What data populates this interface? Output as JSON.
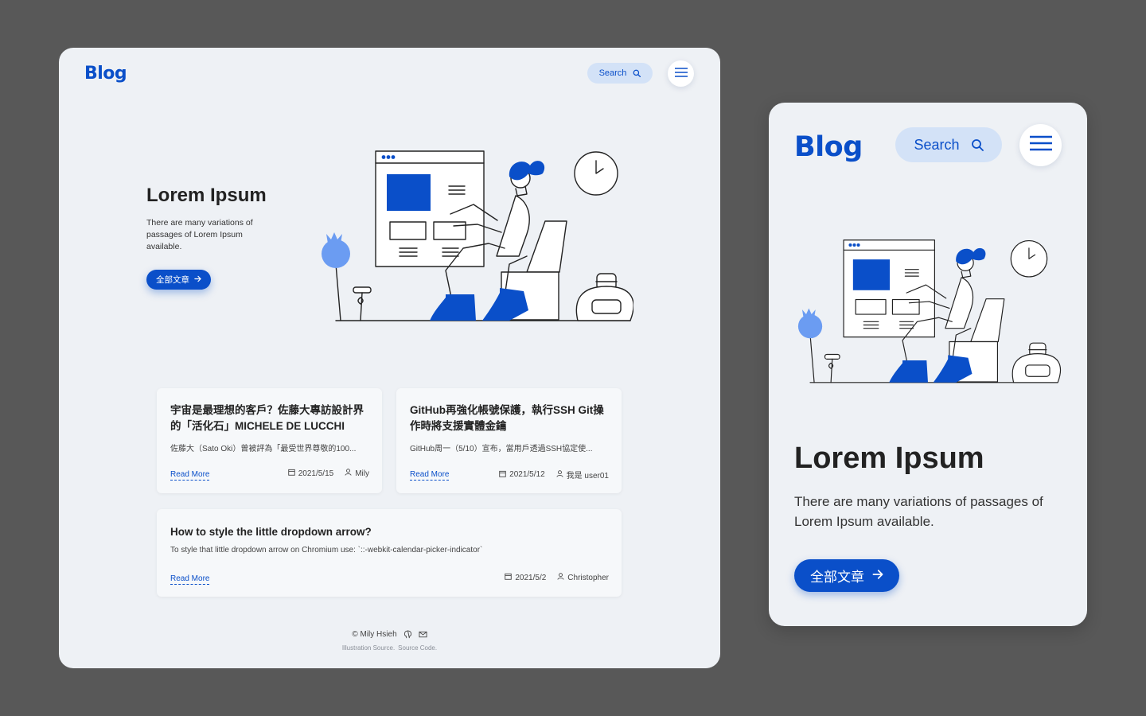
{
  "desktop": {
    "logo": "Blog",
    "search_label": "Search",
    "hero": {
      "title": "Lorem Ipsum",
      "description": "There are many variations of passages of Lorem Ipsum available.",
      "cta_label": "全部文章"
    },
    "posts": [
      {
        "title": "宇宙是最理想的客戶？佐藤大專訪設計界的「活化石」MICHELE DE LUCCHI",
        "excerpt": "佐藤大（Sato Oki）曾被評為「最受世界尊敬的100...",
        "read_more": "Read More",
        "date": "2021/5/15",
        "author": "Mily"
      },
      {
        "title": "GitHub再強化帳號保護，執行SSH Git操作時將支援實體金鑰",
        "excerpt": "GitHub周一（5/10）宣布，當用戶透過SSH協定使...",
        "read_more": "Read More",
        "date": "2021/5/12",
        "author": "我是 user01"
      },
      {
        "title": "How to style the little dropdown arrow?",
        "excerpt": "To style that little dropdown arrow on Chromium use: `::-webkit-calendar-picker-indicator`",
        "read_more": "Read More",
        "date": "2021/5/2",
        "author": "Christopher"
      }
    ],
    "footer": {
      "copyright": "© Mily Hsieh",
      "links": [
        "Illustration Source.",
        "Source Code."
      ]
    }
  },
  "mobile": {
    "logo": "Blog",
    "search_label": "Search",
    "hero": {
      "title": "Lorem Ipsum",
      "description": "There are many variations of passages of Lorem Ipsum available.",
      "cta_label": "全部文章"
    }
  },
  "colors": {
    "accent": "#0a4fc9",
    "search_bg": "#d3e2f7",
    "frame_bg": "#eef1f5",
    "backdrop": "#585858",
    "illustration_light": "#6b9cf2"
  },
  "icons": [
    "search-icon",
    "hamburger-menu-icon",
    "arrow-right-icon",
    "calendar-icon",
    "user-icon",
    "github-icon",
    "mail-icon"
  ]
}
